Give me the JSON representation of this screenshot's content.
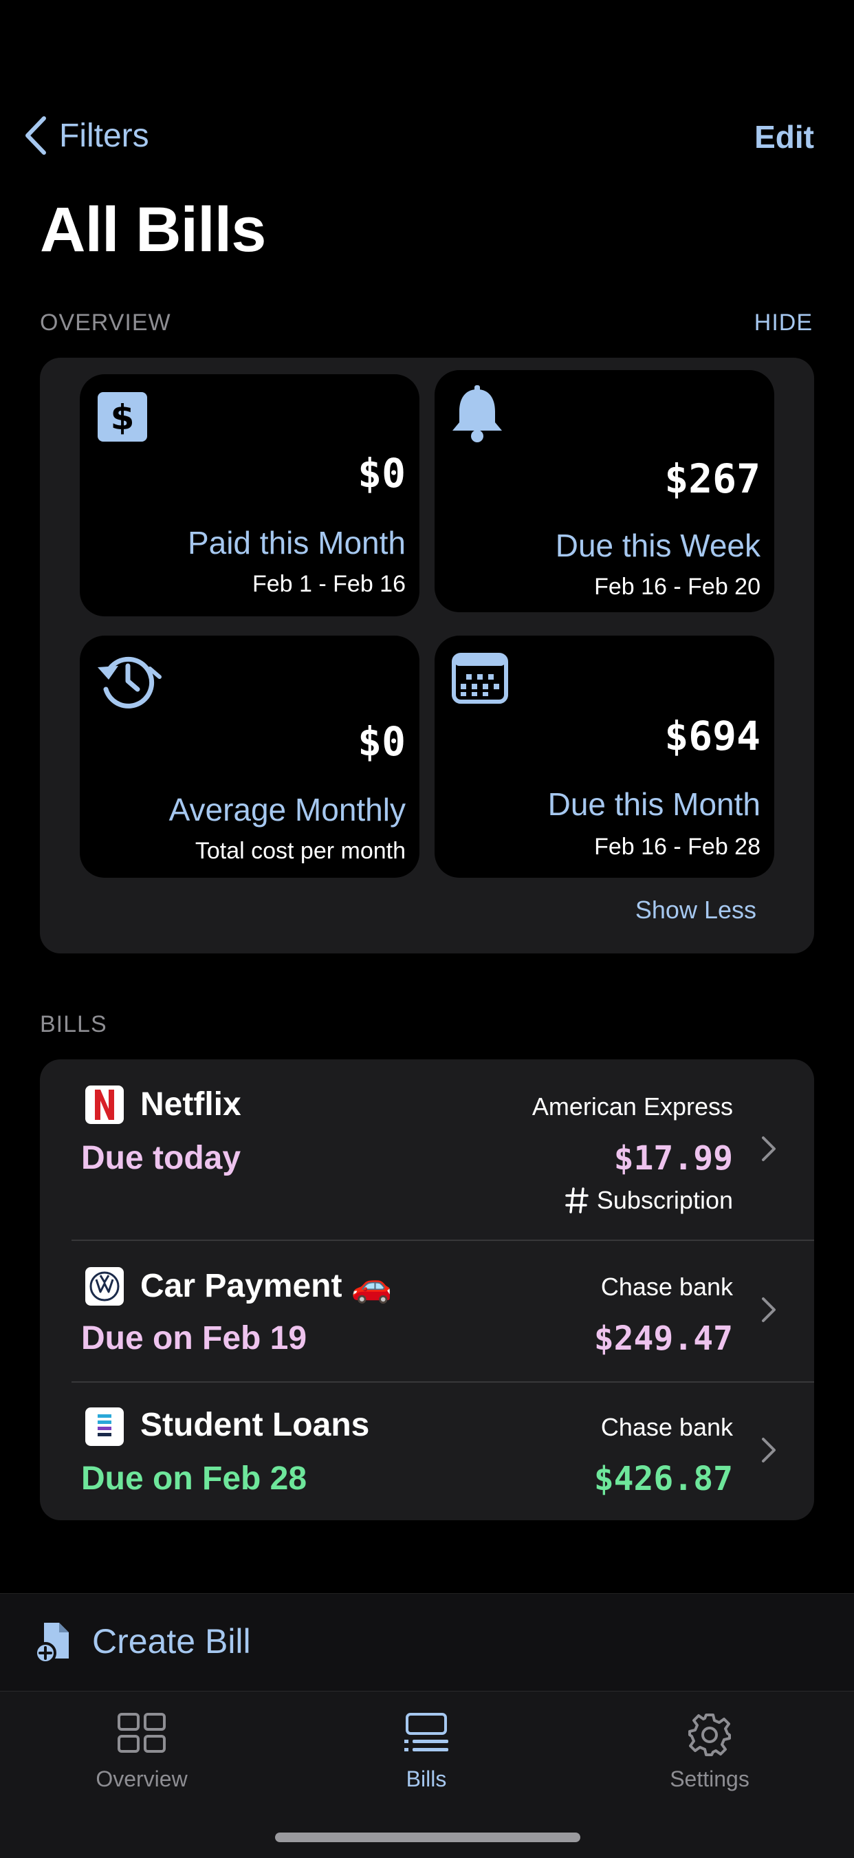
{
  "nav": {
    "back_label": "Filters",
    "edit_label": "Edit"
  },
  "page": {
    "title": "All Bills"
  },
  "overview": {
    "section_label": "OVERVIEW",
    "hide_label": "HIDE",
    "cards": [
      {
        "icon": "dollar-icon",
        "amount": "$0",
        "label": "Paid this Month",
        "sub": "Feb 1 - Feb 16"
      },
      {
        "icon": "bell-icon",
        "amount": "$267",
        "label": "Due this Week",
        "sub": "Feb 16 - Feb 20"
      },
      {
        "icon": "history-icon",
        "amount": "$0",
        "label": "Average Monthly",
        "sub": "Total cost per month"
      },
      {
        "icon": "calendar-icon",
        "amount": "$694",
        "label": "Due this Month",
        "sub": "Feb 16 - Feb 28"
      }
    ],
    "show_less_label": "Show Less"
  },
  "bills": {
    "section_label": "BILLS",
    "items": [
      {
        "logo": "netflix-logo",
        "name": "Netflix",
        "bank": "American Express",
        "due": "Due today",
        "price": "$17.99",
        "tag": "Subscription",
        "status_color": "#eec3ee"
      },
      {
        "logo": "volkswagen-logo",
        "name": "Car Payment 🚗",
        "bank": "Chase bank",
        "due": "Due on Feb 19",
        "price": "$249.47",
        "status_color": "#eec3ee"
      },
      {
        "logo": "loan-logo",
        "name": "Student Loans",
        "bank": "Chase bank",
        "due": "Due on Feb 28",
        "price": "$426.87",
        "status_color": "#6ee69b"
      }
    ]
  },
  "create": {
    "label": "Create Bill"
  },
  "tabbar": {
    "tabs": [
      {
        "label": "Overview",
        "icon": "grid-icon",
        "active": false
      },
      {
        "label": "Bills",
        "icon": "bills-list-icon",
        "active": true
      },
      {
        "label": "Settings",
        "icon": "gear-icon",
        "active": false
      }
    ]
  },
  "colors": {
    "accent": "#a6c8f0",
    "due_soon": "#eec3ee",
    "due_later": "#6ee69b",
    "panel": "#1c1c1e",
    "background": "#000000"
  }
}
